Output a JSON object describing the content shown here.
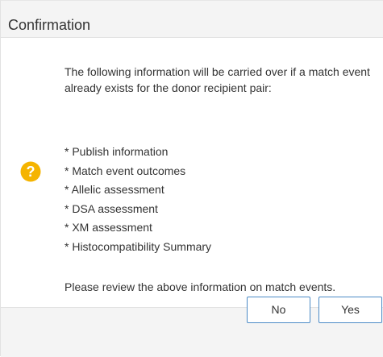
{
  "dialog": {
    "title": "Confirmation",
    "icon": "question-circle-icon",
    "icon_color": "#f5b400",
    "message": "The following information will be carried over if a match event already exists for the donor recipient pair:",
    "items": [
      "* Publish information",
      "* Match event outcomes",
      "* Allelic assessment",
      "* DSA assessment",
      "* XM assessment",
      "* Histocompatibility Summary"
    ],
    "note": "Please review the above information on match events.",
    "buttons": {
      "no": "No",
      "yes": "Yes"
    },
    "accent_color": "#4c8bc6"
  }
}
